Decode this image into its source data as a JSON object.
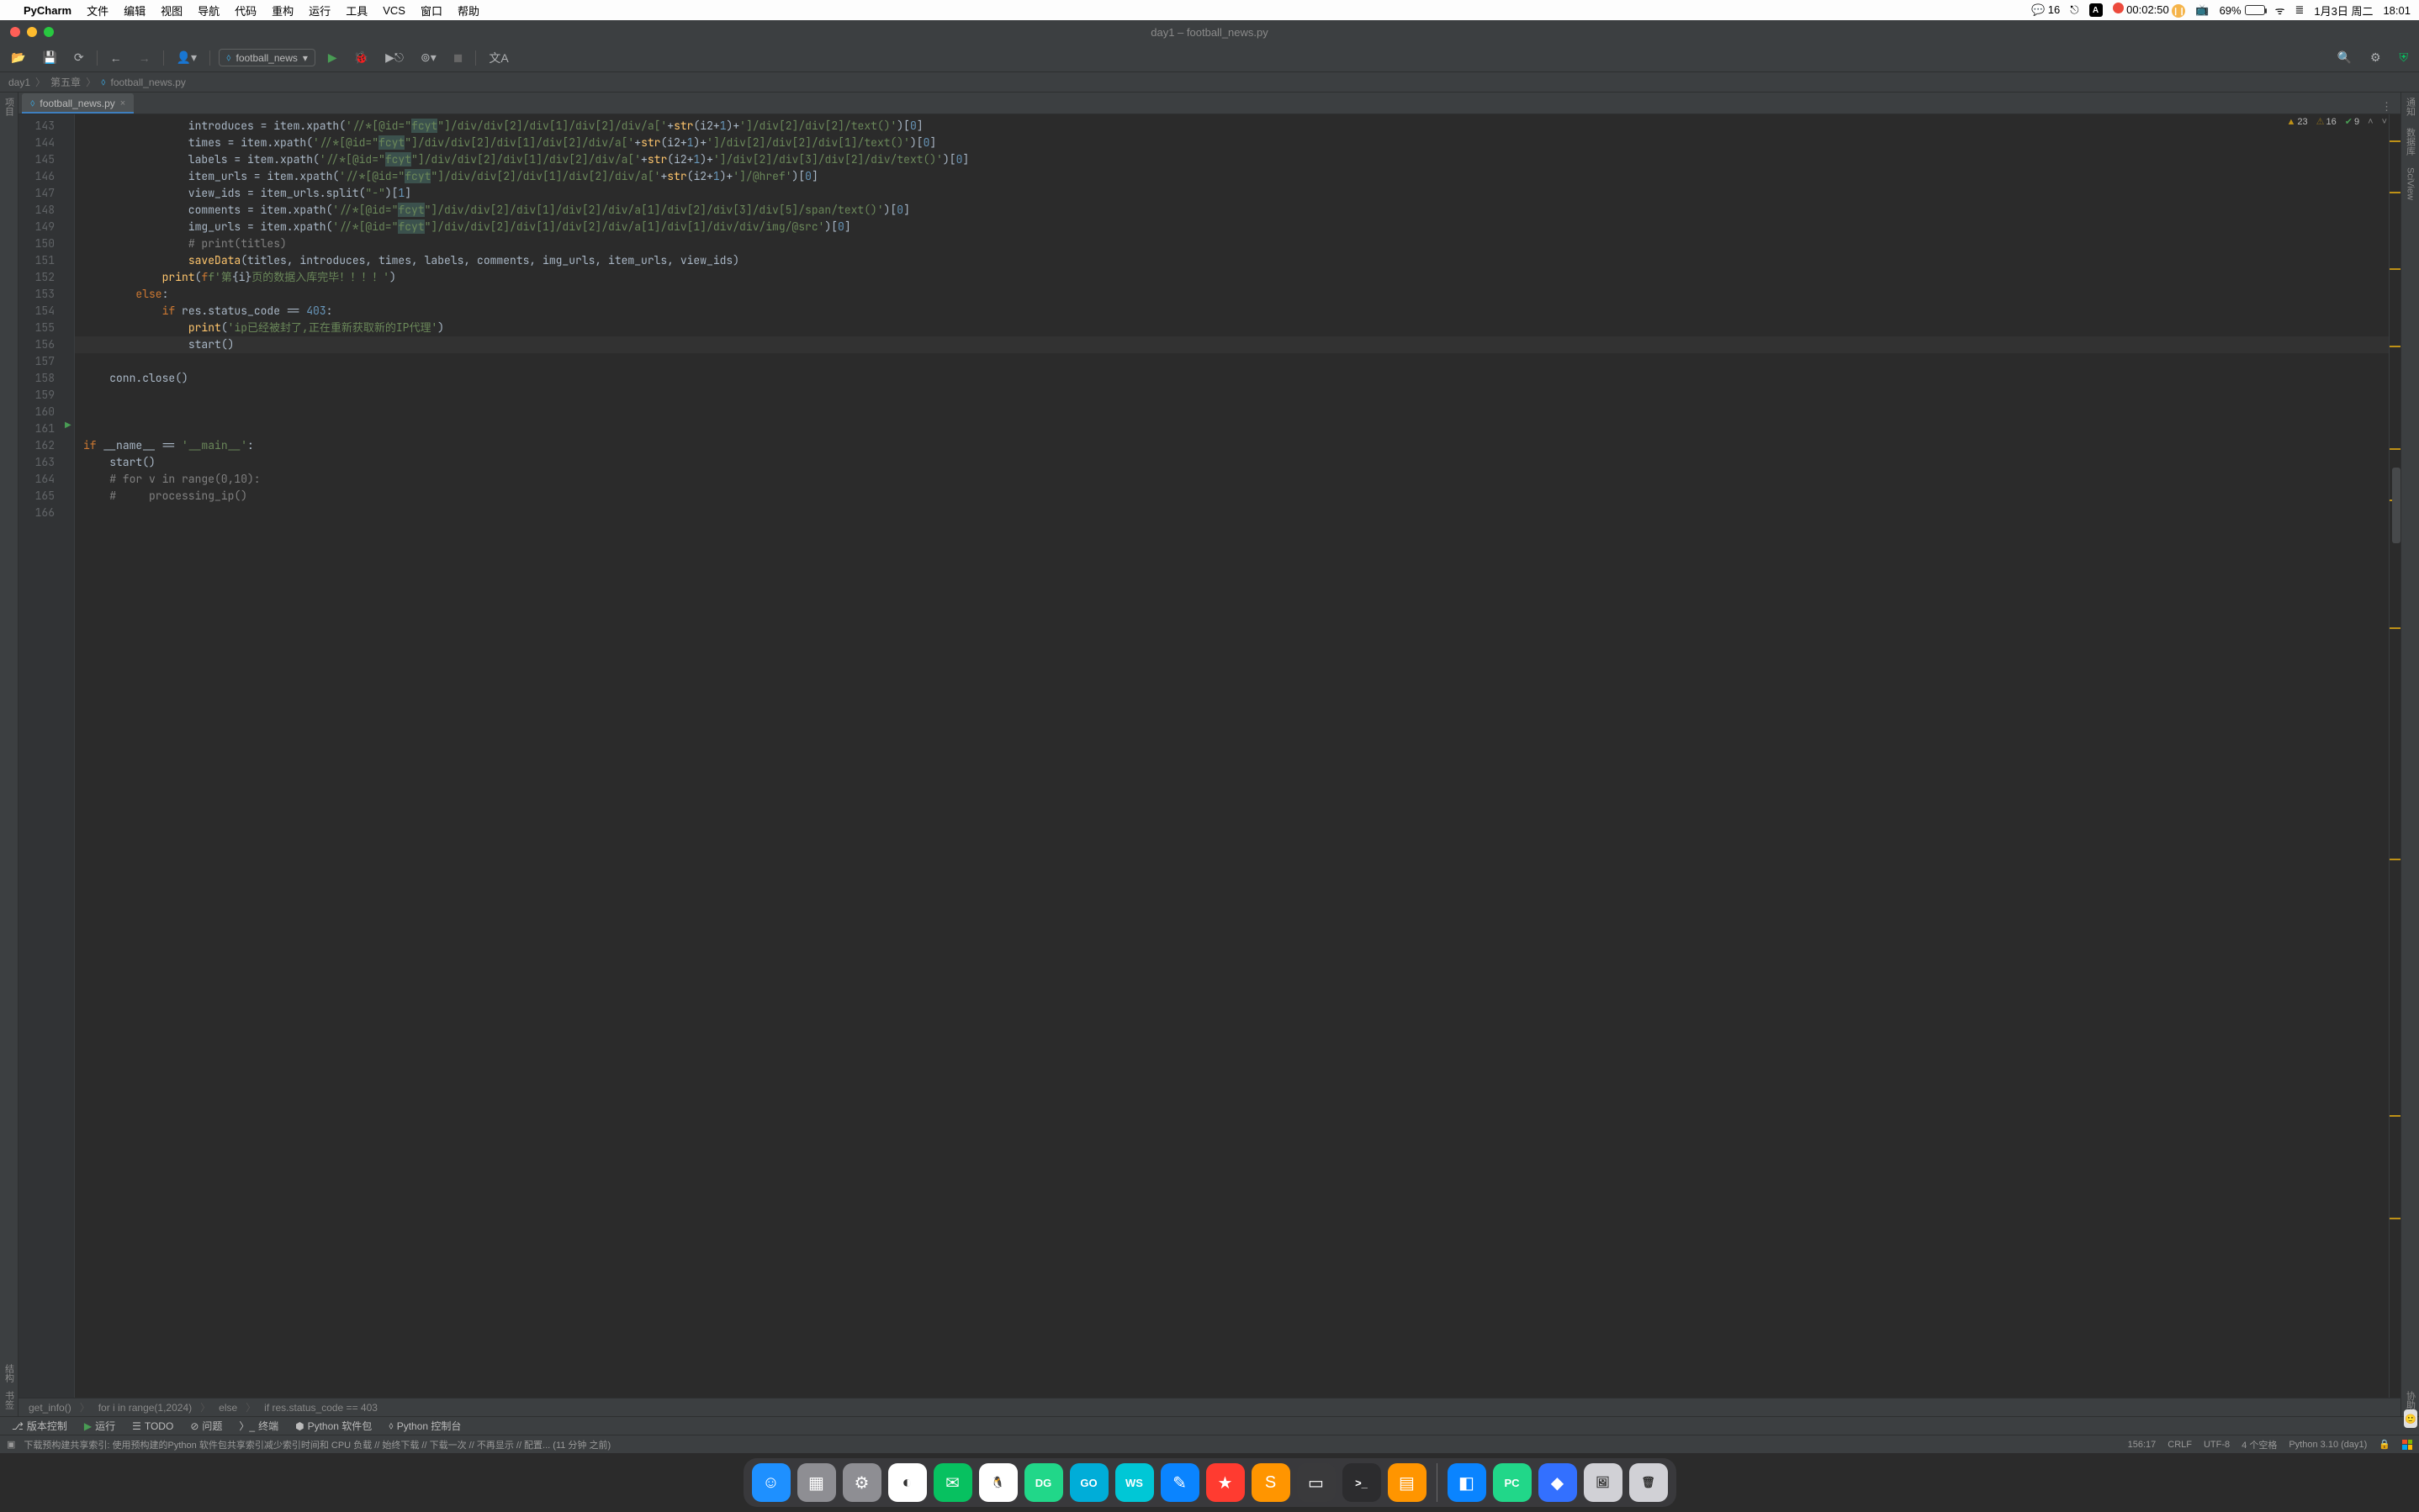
{
  "mac_menu": {
    "app_name": "PyCharm",
    "items": [
      "文件",
      "编辑",
      "视图",
      "导航",
      "代码",
      "重构",
      "运行",
      "工具",
      "VCS",
      "窗口",
      "帮助"
    ]
  },
  "tray": {
    "wechat_count": "16",
    "input_badge": "A",
    "rec_time": "00:02:50",
    "battery_pct": "69%",
    "battery_fill_pct": 69,
    "date": "1月3日 周二",
    "time": "18:01"
  },
  "window": {
    "title": "day1 – football_news.py"
  },
  "toolbar": {
    "run_config_label": "football_news"
  },
  "breadcrumbs": {
    "p1": "day1",
    "p2": "第五章",
    "p3": "football_news.py"
  },
  "left_rail": {
    "project": "项目",
    "structure": "结构",
    "bookmark": "书签"
  },
  "right_rail": {
    "notify": "通知",
    "db": "数据库",
    "sci": "SciView",
    "assist": "协助"
  },
  "tab": {
    "name": "football_news.py"
  },
  "inspection": {
    "errors": "23",
    "warnings": "16",
    "ok": "9"
  },
  "gutter": {
    "start": 143,
    "end": 166
  },
  "code": {
    "l143_var": "introduces",
    "l143_xpath_a": "'//*[@id=\"",
    "fcyt": "fcyt",
    "l143_xpath_b": "\"]/div/div[2]/div[1]/div[2]/div/a['",
    "plus": "+",
    "str_fn": "str",
    "i2p1": "i2",
    "one": "1",
    "l143_xpath_c": "']/div[2]/div[2]/text()'",
    "idx0": "0",
    "l144_var": "times",
    "l144_b": "\"]/div/div[2]/div[1]/div[2]/div/a['",
    "l144_c": "']/div[2]/div[2]/div[1]/text()'",
    "l145_var": "labels",
    "l145_b": "\"]/div/div[2]/div[1]/div[2]/div/a['",
    "l145_c": "']/div[2]/div[3]/div[2]/div/text()'",
    "l146_var": "item_urls",
    "l146_b": "\"]/div/div[2]/div[1]/div[2]/div/a['",
    "l146_c": "']/@href'",
    "l147_var": "view_ids",
    "l147_split_arg": "\"-\"",
    "l147_idx": "1",
    "l148_var": "comments",
    "l148_b": "\"]/div/div[2]/div[1]/div[2]/div/a[1]/div[2]/div[3]/div[5]/span/text()'",
    "l149_var": "img_urls",
    "l149_b": "\"]/div/div[2]/div[1]/div[2]/div/a[1]/div[1]/div/div/img/@src'",
    "l150_cmt": "# print(titles)",
    "l151_fn": "saveData",
    "l151_args": "titles, introduces, times, labels, comments, img_urls, item_urls, view_ids",
    "l152_prefix": "f'第",
    "l152_var": "i",
    "l152_suffix": "页的数据入库完毕！！！！'",
    "l153_else": "else",
    "l154_if": "if",
    "l154_expr": "res.status_code == ",
    "l154_num": "403",
    "l155_str": "'ip已经被封了,正在重新获取新的IP代理'",
    "l156_call": "start()",
    "l157": "conn.close()",
    "l161_if": "if",
    "l161_name": "__name__",
    "l161_eq": " == ",
    "l161_main": "'__main__'",
    "l162": "start()",
    "l163_cmt": "# for v in range(0,10):",
    "l164_cmt": "#     processing_ip()"
  },
  "struct_crumb": {
    "c1": "get_info()",
    "c2": "for i in range(1,2024)",
    "c3": "else",
    "c4": "if res.status_code == 403"
  },
  "toolwins": {
    "vcs": "版本控制",
    "run": "运行",
    "todo": "TODO",
    "problems": "问题",
    "terminal": "终端",
    "pypkg": "Python 软件包",
    "pyconsole": "Python 控制台"
  },
  "status": {
    "msg": "下载预构建共享索引: 使用预构建的Python 软件包共享索引减少索引时间和 CPU 负载 // 始终下载 // 下载一次 // 不再显示 // 配置...  (11 分钟 之前)",
    "pos": "156:17",
    "eol": "CRLF",
    "enc": "UTF-8",
    "indent": "4 个空格",
    "interp": "Python 3.10 (day1)"
  },
  "dock_apps": [
    {
      "name": "finder",
      "bg": "#1e90ff",
      "glyph": "☺"
    },
    {
      "name": "launchpad",
      "bg": "#8e8e93",
      "glyph": "▦"
    },
    {
      "name": "settings",
      "bg": "#8e8e93",
      "glyph": "⚙"
    },
    {
      "name": "chrome",
      "bg": "#ffffff",
      "glyph": "◐"
    },
    {
      "name": "wechat",
      "bg": "#07c160",
      "glyph": "✉"
    },
    {
      "name": "qq",
      "bg": "#ffffff",
      "glyph": "🐧"
    },
    {
      "name": "datagrip",
      "bg": "#21d789",
      "glyph": "DG"
    },
    {
      "name": "goland",
      "bg": "#00add8",
      "glyph": "GO"
    },
    {
      "name": "webstorm",
      "bg": "#00c7d6",
      "glyph": "WS"
    },
    {
      "name": "notes",
      "bg": "#0a84ff",
      "glyph": "✎"
    },
    {
      "name": "star",
      "bg": "#ff3b30",
      "glyph": "★"
    },
    {
      "name": "sublime",
      "bg": "#ff9500",
      "glyph": "S"
    },
    {
      "name": "app2",
      "bg": "#3a3a3c",
      "glyph": "▭"
    },
    {
      "name": "iterm",
      "bg": "#2c2c2e",
      "glyph": ">_"
    },
    {
      "name": "calc",
      "bg": "#ff9500",
      "glyph": "▤"
    },
    {
      "name": "sep",
      "bg": "",
      "glyph": ""
    },
    {
      "name": "spaces",
      "bg": "#0a84ff",
      "glyph": "◧"
    },
    {
      "name": "pycharm",
      "bg": "#21d789",
      "glyph": "PC"
    },
    {
      "name": "feishu",
      "bg": "#3370ff",
      "glyph": "◆"
    },
    {
      "name": "preview",
      "bg": "#d1d1d6",
      "glyph": "🖼"
    },
    {
      "name": "trash",
      "bg": "#d1d1d6",
      "glyph": "🗑"
    }
  ]
}
